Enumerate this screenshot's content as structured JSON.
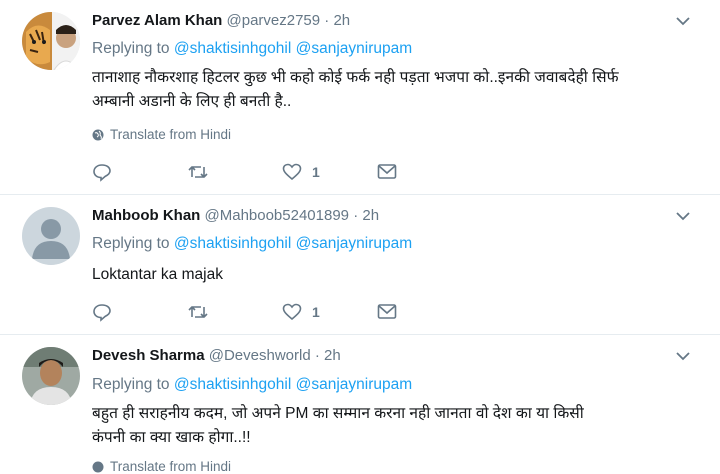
{
  "tweets": [
    {
      "name": "Parvez Alam Khan",
      "handle": "@parvez2759",
      "time": "2h",
      "reply_prefix": "Replying to",
      "mention1": "@shaktisinhgohil",
      "mention2": "@sanjaynirupam",
      "text_line1": "तानाशाह नौकरशाह हिटलर कुछ भी कहो कोई फर्क नही पड़ता भजपा को..इनकी जवाबदेही सिर्फ",
      "text_line2": "अम्बानी अडानी के लिए ही बनती है..",
      "translate": "Translate from Hindi",
      "like_count": "1",
      "avatar": "tiger-and-man-photo"
    },
    {
      "name": "Mahboob Khan",
      "handle": "@Mahboob52401899",
      "time": "2h",
      "reply_prefix": "Replying to",
      "mention1": "@shaktisinhgohil",
      "mention2": "@sanjaynirupam",
      "text_line1": "Loktantar ka majak",
      "like_count": "1",
      "avatar": "default-egg-avatar"
    },
    {
      "name": "Devesh Sharma",
      "handle": "@Deveshworld",
      "time": "2h",
      "reply_prefix": "Replying to",
      "mention1": "@shaktisinhgohil",
      "mention2": "@sanjaynirupam",
      "text_line1": "बहुत ही सराहनीय कदम, जो अपने PM का सम्मान करना नही जानता वो देश का या किसी",
      "text_line2": "कंपनी का क्या खाक होगा..!!",
      "translate": "Translate from Hindi",
      "avatar": "man-photo"
    }
  ],
  "colors": {
    "link": "#1da1f2",
    "muted": "#657786",
    "text": "#14171a",
    "divider": "#e6ecf0"
  }
}
